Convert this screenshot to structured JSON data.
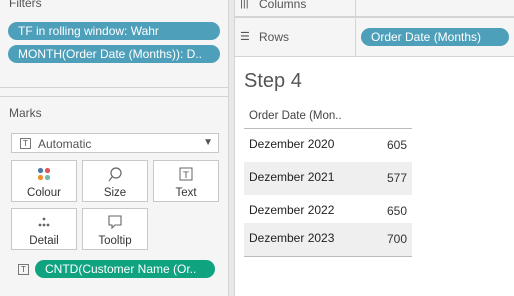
{
  "filters": {
    "title": "Filters",
    "items": [
      "TF in rolling window: Wahr",
      "MONTH(Order Date (Months)): D.."
    ]
  },
  "marks": {
    "title": "Marks",
    "type_label": "Automatic",
    "buttons": [
      {
        "label": "Colour",
        "icon": "colour-dots-icon"
      },
      {
        "label": "Size",
        "icon": "size-icon"
      },
      {
        "label": "Text",
        "icon": "text-icon"
      },
      {
        "label": "Detail",
        "icon": "detail-icon"
      },
      {
        "label": "Tooltip",
        "icon": "tooltip-icon"
      }
    ],
    "field_pill": "CNTD(Customer Name (Or.."
  },
  "shelves": {
    "columns_label": "Columns",
    "rows_label": "Rows",
    "rows_pill": "Order Date (Months)"
  },
  "view": {
    "title": "Step 4",
    "column_header": "Order Date (Mon..",
    "rows": [
      {
        "date": "Dezember 2020",
        "value": "605"
      },
      {
        "date": "Dezember 2021",
        "value": "577"
      },
      {
        "date": "Dezember 2022",
        "value": "650"
      },
      {
        "date": "Dezember 2023",
        "value": "700"
      }
    ]
  }
}
